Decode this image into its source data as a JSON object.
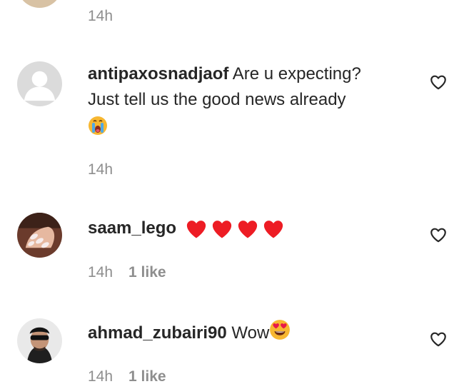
{
  "top_comment": {
    "time": "14h"
  },
  "comments": [
    {
      "username": "antipaxosnadjaof",
      "text_line1": "Are u expecting?",
      "text_line2": "Just tell us the good news already",
      "emoji_icon": "loudly-crying-face-icon",
      "time": "14h",
      "likes": ""
    },
    {
      "username": "saam_lego",
      "emoji_icon": "red-heart-icon",
      "emoji_count": 4,
      "time": "14h",
      "likes": "1 like"
    },
    {
      "username": "ahmad_zubairi90",
      "text_line1": "Wow",
      "emoji_icon": "heart-eyes-face-icon",
      "time": "14h",
      "likes": "1 like"
    }
  ],
  "colors": {
    "text": "#262626",
    "meta": "#8e8e8e",
    "heart_red": "#ed1c24",
    "emoji_yellow": "#f7b731"
  }
}
